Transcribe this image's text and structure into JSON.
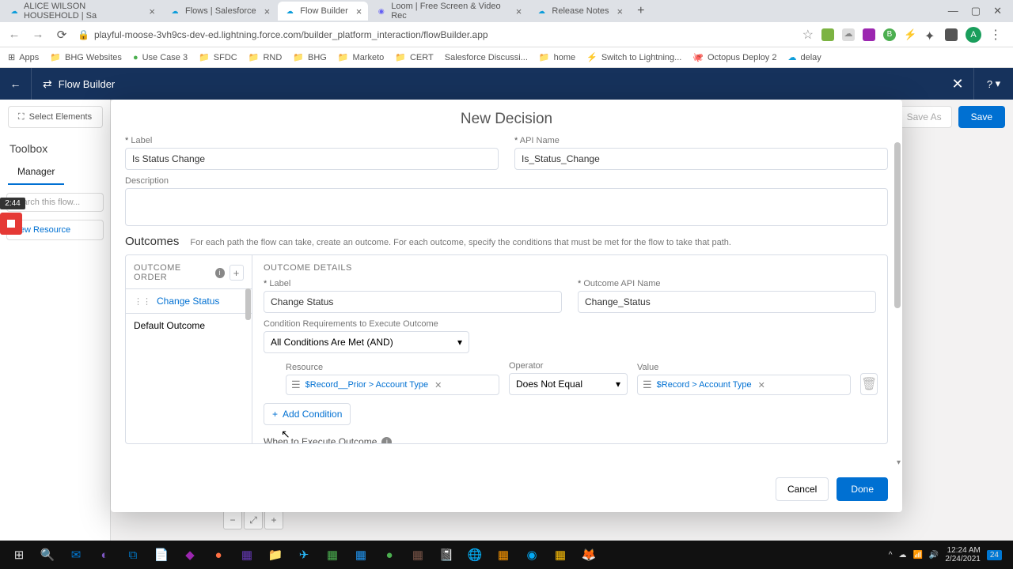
{
  "browser": {
    "tabs": [
      {
        "title": "ALICE WILSON HOUSEHOLD | Sa"
      },
      {
        "title": "Flows | Salesforce"
      },
      {
        "title": "Flow Builder"
      },
      {
        "title": "Loom | Free Screen & Video Rec"
      },
      {
        "title": "Release Notes"
      }
    ],
    "url": "playful-moose-3vh9cs-dev-ed.lightning.force.com/builder_platform_interaction/flowBuilder.app",
    "avatar": "A"
  },
  "bookmarks": [
    "Apps",
    "BHG Websites",
    "Use Case 3",
    "SFDC",
    "RND",
    "BHG",
    "Marketo",
    "CERT",
    "Salesforce Discussi...",
    "home",
    "Switch to Lightning...",
    "Octopus Deploy 2",
    "delay"
  ],
  "app": {
    "title": "Flow Builder",
    "help": "?",
    "select_elements": "Select Elements",
    "toolbox": "Toolbox",
    "manager": "Manager",
    "search_ph": "Search this flow...",
    "new_resource": "New Resource",
    "save_as": "Save As",
    "save": "Save"
  },
  "modal": {
    "title": "New Decision",
    "label_lbl": "Label",
    "label_val": "Is Status Change",
    "api_lbl": "API Name",
    "api_val": "Is_Status_Change",
    "desc_lbl": "Description",
    "desc_val": "",
    "outcomes_h": "Outcomes",
    "outcomes_sub": "For each path the flow can take, create an outcome. For each outcome, specify the conditions that must be met for the flow to take that path.",
    "order_h": "OUTCOME ORDER",
    "order_items": [
      {
        "label": "Change Status",
        "active": true
      },
      {
        "label": "Default Outcome",
        "active": false
      }
    ],
    "details_h": "OUTCOME DETAILS",
    "o_label_lbl": "Label",
    "o_label_val": "Change Status",
    "o_api_lbl": "Outcome API Name",
    "o_api_val": "Change_Status",
    "cond_req_lbl": "Condition Requirements to Execute Outcome",
    "cond_req_val": "All Conditions Are Met (AND)",
    "resource_lbl": "Resource",
    "operator_lbl": "Operator",
    "value_lbl": "Value",
    "resource_val": "$Record__Prior > Account Type",
    "operator_val": "Does Not Equal",
    "value_val": "$Record > Account Type",
    "add_cond": "Add Condition",
    "exec_lbl": "When to Execute Outcome",
    "cancel": "Cancel",
    "done": "Done"
  },
  "rec": {
    "time": "2:44"
  },
  "tray": {
    "time": "12:24 AM",
    "date": "2/24/2021",
    "badge": "24"
  }
}
